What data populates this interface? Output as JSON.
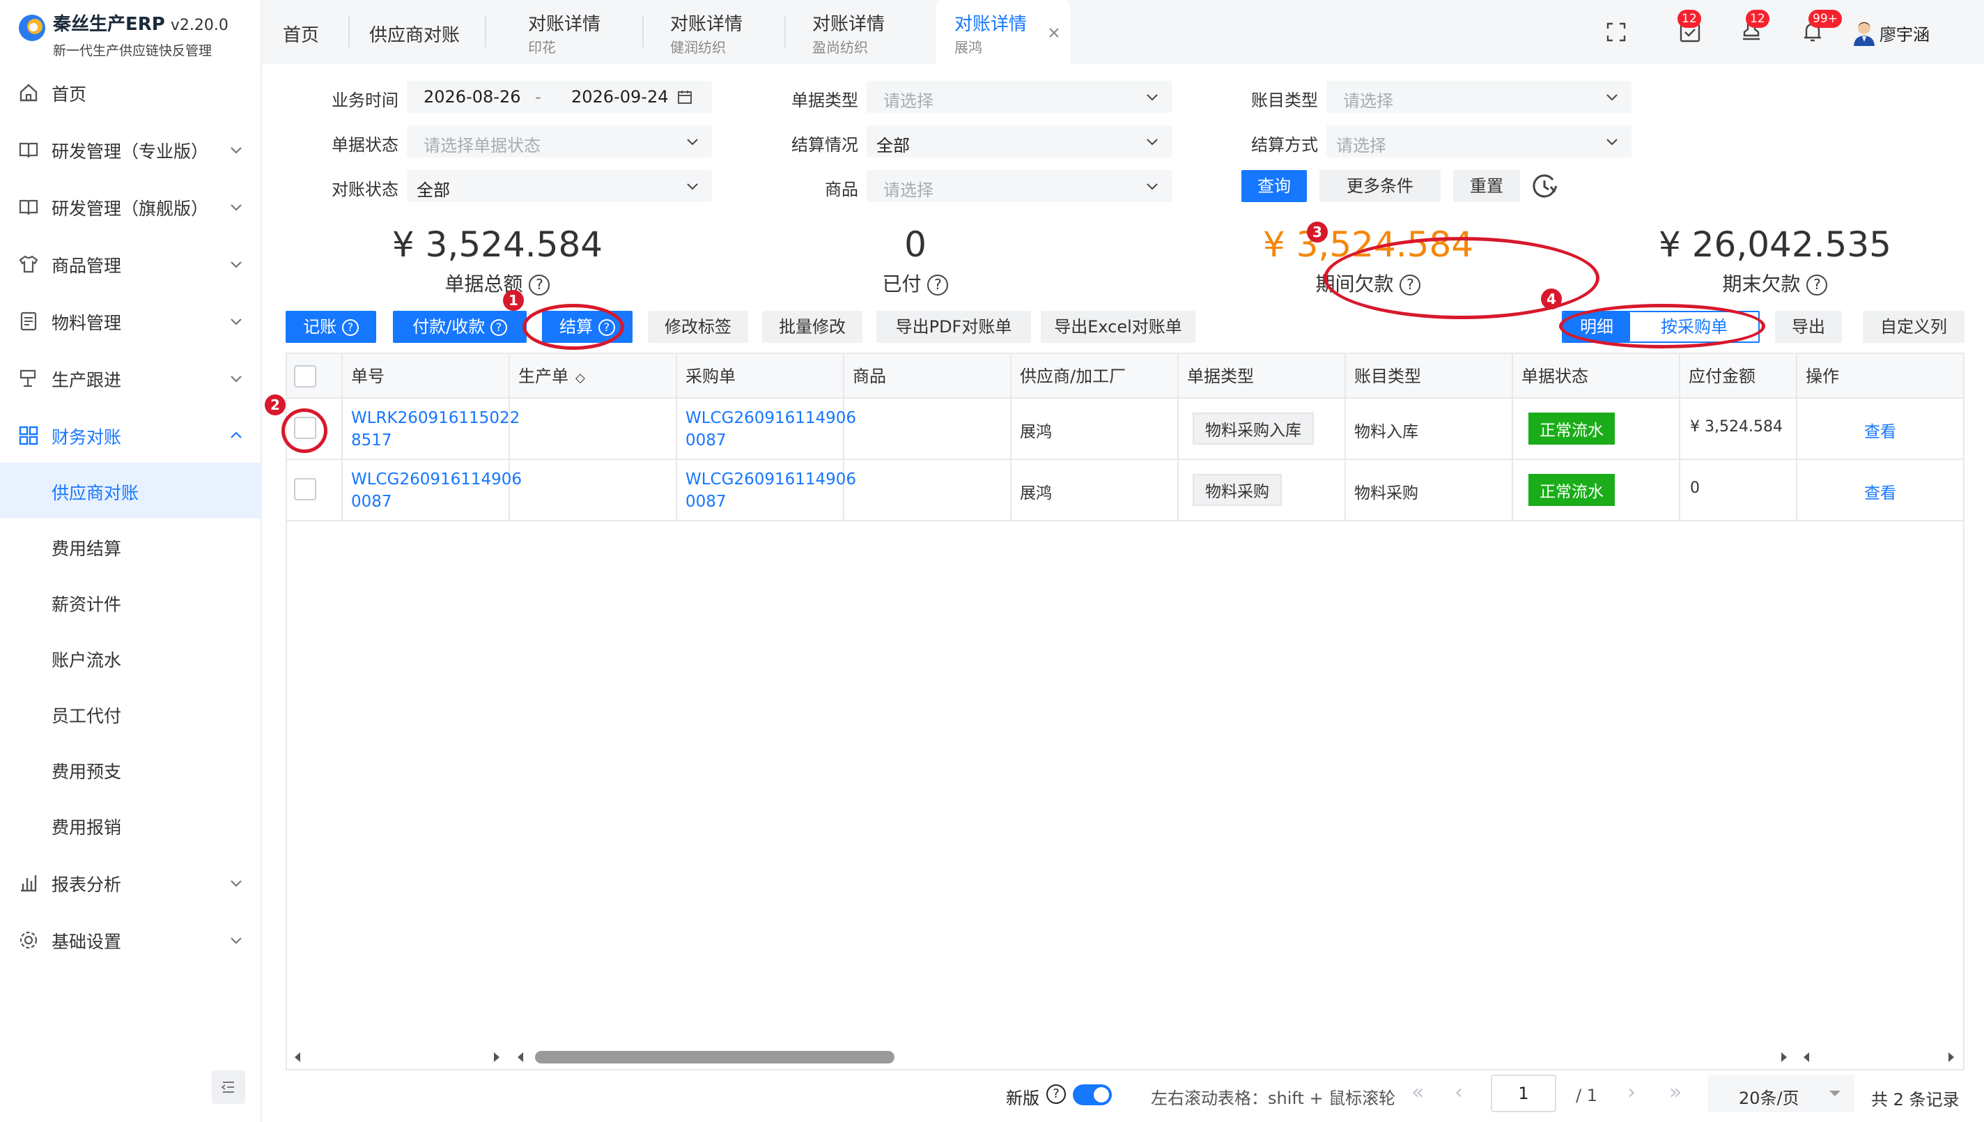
{
  "app": {
    "name": "秦丝生产ERP",
    "version": "v2.20.0",
    "tagline": "新一代生产供应链快反管理"
  },
  "sidebar": {
    "items": [
      {
        "label": "首页"
      },
      {
        "label": "研发管理（专业版）"
      },
      {
        "label": "研发管理（旗舰版）"
      },
      {
        "label": "商品管理"
      },
      {
        "label": "物料管理"
      },
      {
        "label": "生产跟进"
      },
      {
        "label": "财务对账"
      },
      {
        "label": "报表分析"
      },
      {
        "label": "基础设置"
      }
    ],
    "submenu": [
      "供应商对账",
      "费用结算",
      "薪资计件",
      "账户流水",
      "员工代付",
      "费用预支",
      "费用报销"
    ]
  },
  "tabs": [
    {
      "label": "首页"
    },
    {
      "label": "供应商对账"
    },
    {
      "label": "对账详情",
      "sub": "印花"
    },
    {
      "label": "对账详情",
      "sub": "健润纺织"
    },
    {
      "label": "对账详情",
      "sub": "盈尚纺织"
    },
    {
      "label": "对账详情",
      "sub": "展鸿"
    }
  ],
  "header": {
    "badges": [
      "12",
      "12",
      "99+"
    ],
    "user": "廖宇涵"
  },
  "filters": {
    "biz_time_label": "业务时间",
    "date_start": "2026-08-26",
    "date_sep": "-",
    "date_end": "2026-09-24",
    "doc_type_label": "单据类型",
    "doc_type_ph": "请选择",
    "acct_type_label": "账目类型",
    "acct_type_ph": "请选择",
    "doc_status_label": "单据状态",
    "doc_status_ph": "请选择单据状态",
    "settle_label": "结算情况",
    "settle_val": "全部",
    "settle_method_label": "结算方式",
    "settle_method_ph": "请选择",
    "recon_label": "对账状态",
    "recon_val": "全部",
    "goods_label": "商品",
    "goods_ph": "请选择",
    "query": "查询",
    "more": "更多条件",
    "reset": "重置"
  },
  "stats": [
    {
      "value": "¥ 3,524.584",
      "label": "单据总额"
    },
    {
      "value": "0",
      "label": "已付"
    },
    {
      "value": "¥ 3,524.584",
      "label": "期间欠款"
    },
    {
      "value": "¥ 26,042.535",
      "label": "期末欠款"
    }
  ],
  "toolbar": {
    "record": "记账",
    "pay": "付款/收款",
    "settle": "结算",
    "edit_tag": "修改标签",
    "batch": "批量修改",
    "export_pdf": "导出PDF对账单",
    "export_excel": "导出Excel对账单",
    "detail": "明细",
    "by_po": "按采购单",
    "export": "导出",
    "custom_cols": "自定义列"
  },
  "table": {
    "headers": [
      "单号",
      "生产单",
      "采购单",
      "商品",
      "供应商/加工厂",
      "单据类型",
      "账目类型",
      "单据状态",
      "应付金额",
      "操作"
    ],
    "rows": [
      {
        "no1": "WLRK260916115022",
        "no2": "8517",
        "po1": "WLCG260916114906",
        "po2": "0087",
        "supplier": "展鸿",
        "doc_type": "物料采购入库",
        "acct_type": "物料入库",
        "status": "正常流水",
        "amount": "¥ 3,524.584",
        "op": "查看"
      },
      {
        "no1": "WLCG260916114906",
        "no2": "0087",
        "po1": "WLCG260916114906",
        "po2": "0087",
        "supplier": "展鸿",
        "doc_type": "物料采购",
        "acct_type": "物料采购",
        "status": "正常流水",
        "amount": "0",
        "op": "查看"
      }
    ]
  },
  "footer": {
    "new_label": "新版",
    "scroll_hint": "左右滚动表格：shift + 鼠标滚轮",
    "page": "1",
    "page_total": "/ 1",
    "page_size": "20条/页",
    "total": "共 2 条记录"
  },
  "annotations": [
    "1",
    "2",
    "3",
    "4"
  ],
  "colors": {
    "primary": "#1677ff",
    "warning": "#f5870b",
    "success": "#1aad19",
    "annotation": "#d8182b"
  }
}
